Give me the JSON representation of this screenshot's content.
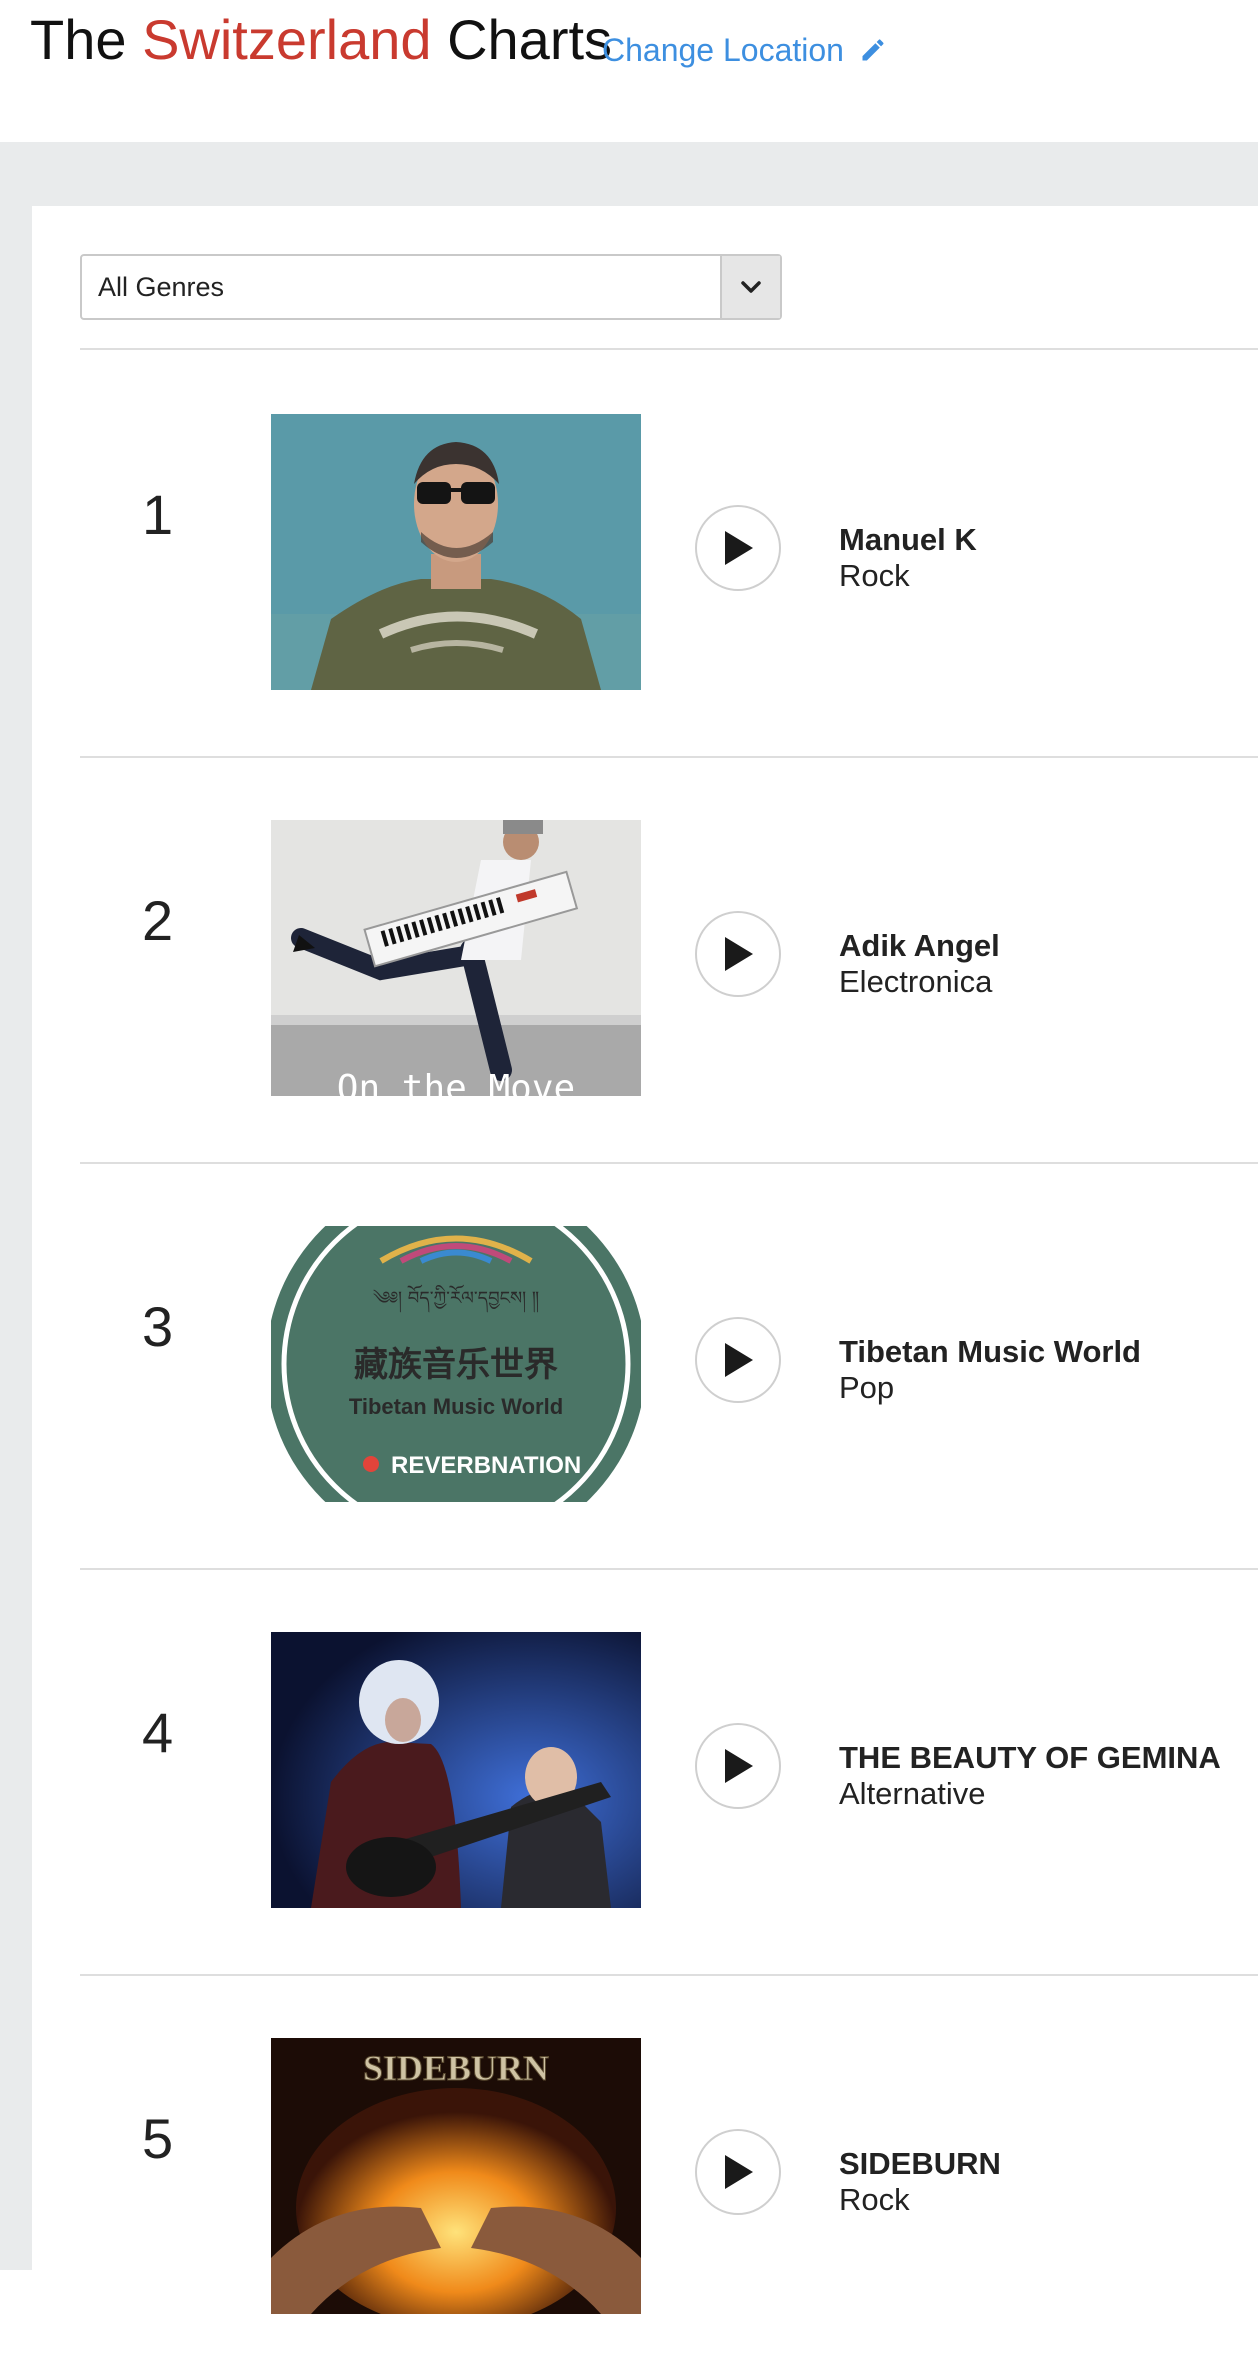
{
  "header": {
    "title_prefix": "The",
    "title_country": "Switzerland",
    "title_suffix": "Charts",
    "change_location": "Change Location",
    "country_color": "#c93a2f",
    "link_color": "#3d8fe0"
  },
  "filter": {
    "selected": "All Genres"
  },
  "chart": [
    {
      "rank": "1",
      "artist": "Manuel K",
      "genre": "Rock"
    },
    {
      "rank": "2",
      "artist": "Adik Angel",
      "genre": "Electronica",
      "art_text": "On the Move"
    },
    {
      "rank": "3",
      "artist": "Tibetan Music World",
      "genre": "Pop",
      "art_text_cn": "藏族音乐世界",
      "art_text_en": "Tibetan Music World",
      "art_text_brand": "REVERBNATION"
    },
    {
      "rank": "4",
      "artist": "THE BEAUTY OF GEMINA",
      "genre": "Alternative"
    },
    {
      "rank": "5",
      "artist": "SIDEBURN",
      "genre": "Rock",
      "art_text": "SIDEBURN"
    }
  ]
}
